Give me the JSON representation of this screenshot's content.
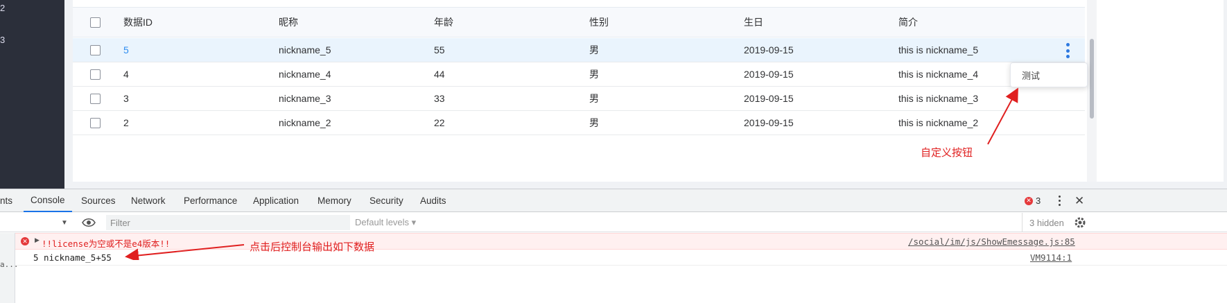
{
  "sidebar": {
    "fragments": [
      "2",
      "3"
    ]
  },
  "table": {
    "headers": {
      "id": "数据ID",
      "nickname": "昵称",
      "age": "年龄",
      "gender": "性别",
      "birthday": "生日",
      "intro": "简介"
    },
    "rows": [
      {
        "id": "5",
        "nickname": "nickname_5",
        "age": "55",
        "gender": "男",
        "birthday": "2019-09-15",
        "intro": "this is nickname_5",
        "selected": true
      },
      {
        "id": "4",
        "nickname": "nickname_4",
        "age": "44",
        "gender": "男",
        "birthday": "2019-09-15",
        "intro": "this is nickname_4",
        "selected": false
      },
      {
        "id": "3",
        "nickname": "nickname_3",
        "age": "33",
        "gender": "男",
        "birthday": "2019-09-15",
        "intro": "this is nickname_3",
        "selected": false
      },
      {
        "id": "2",
        "nickname": "nickname_2",
        "age": "22",
        "gender": "男",
        "birthday": "2019-09-15",
        "intro": "this is nickname_2",
        "selected": false
      }
    ],
    "row_menu_icon": "more-vertical-icon",
    "dropdown_item": "测试"
  },
  "annotations": {
    "custom_button": "自定义按钮",
    "console_output": "点击后控制台输出如下数据"
  },
  "devtools": {
    "tabs": [
      "nts",
      "Console",
      "Sources",
      "Network",
      "Performance",
      "Application",
      "Memory",
      "Security",
      "Audits"
    ],
    "active_tab": "Console",
    "error_count": "3",
    "error_badge_icon": "✕",
    "toolbar": {
      "filter_placeholder": "Filter",
      "levels": "Default levels ▾",
      "hidden": "3 hidden"
    },
    "console": {
      "error_message": "!!license为空或不是e4版本!!",
      "error_source": "/social/im/js/ShowEmessage.js:85",
      "log_message": "5 nickname_5+55",
      "log_source": "VM9114:1",
      "gutter_fragment": "a..."
    }
  },
  "colors": {
    "accent": "#2d8cf0",
    "annotation": "#e02020",
    "selected_row": "#eaf4fd",
    "error_bg": "#fff0f0"
  }
}
